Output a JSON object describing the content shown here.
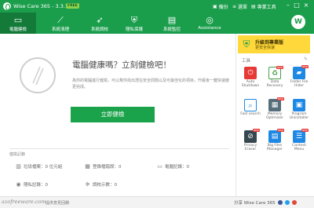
{
  "titlebar": {
    "title": "Wise Care 365 - 3.3.1",
    "badge": "FREE",
    "menu": [
      "備份",
      "選單",
      "專業工具"
    ]
  },
  "tabs": [
    {
      "label": "電腦健檢",
      "icon": "monitor-icon",
      "active": true
    },
    {
      "label": "系統清理",
      "icon": "broom-icon",
      "active": false
    },
    {
      "label": "系統調校",
      "icon": "rocket-icon",
      "active": false
    },
    {
      "label": "隱私保護",
      "icon": "shield-icon",
      "active": false
    },
    {
      "label": "系統監控",
      "icon": "chart-icon",
      "active": false
    },
    {
      "label": "Assistance",
      "icon": "compass-icon",
      "active": false
    }
  ],
  "avatar": {
    "letter": "W"
  },
  "main": {
    "headline": "電腦健康嗎？立刻健檢吧！",
    "description": "為你的電腦進行健檢，可以幫你找出潛在安全問題以及可最佳化的項目，升級後一鍵快速變更完成。",
    "scan_button": "立即健檢",
    "section_label": "健檢記錄",
    "stats": [
      {
        "icon": "trash-icon",
        "label": "垃圾檔案：0 位元組"
      },
      {
        "icon": "registry-icon",
        "label": "登錄檔錯誤：0"
      },
      {
        "icon": "pc-icon",
        "label": "電腦記錄：0"
      },
      {
        "icon": "eye-icon",
        "label": "隱私記錄：0"
      },
      {
        "icon": "gear-icon",
        "label": "調校示數：0"
      }
    ]
  },
  "promo": {
    "line1": "升級到專業版",
    "line2": "更安全快速"
  },
  "tools": {
    "title": "工具",
    "items": [
      {
        "label": "Auto Shutdown",
        "icon": "power-icon",
        "color": "#e53935",
        "badge": ""
      },
      {
        "label": "Data Recovery",
        "icon": "recovery-icon",
        "color": "#43a047",
        "badge": "NEW"
      },
      {
        "label": "Folder File Hider",
        "icon": "folder-icon",
        "color": "#1e88e5",
        "badge": "NEW"
      },
      {
        "label": "Fast search",
        "icon": "search-icon",
        "color": "#1e88e5",
        "badge": ""
      },
      {
        "label": "Memory Optimizer",
        "icon": "memory-icon",
        "color": "#546e7a",
        "badge": "NEW"
      },
      {
        "label": "Program Uninstaller",
        "icon": "uninstall-icon",
        "color": "#1e88e5",
        "badge": ""
      },
      {
        "label": "Privacy Eraser",
        "icon": "eraser-icon",
        "color": "#37474f",
        "badge": "NEW"
      },
      {
        "label": "Big Files Manager",
        "icon": "bigfile-icon",
        "color": "#1e88e5",
        "badge": "NEW"
      },
      {
        "label": "Context Menu",
        "icon": "menu-icon",
        "color": "#1e88e5",
        "badge": "NEW"
      }
    ]
  },
  "statusbar": {
    "watermark": "azofreeware.com",
    "feedback": "提供意見回饋",
    "share": "分享 Wise Care 365"
  }
}
